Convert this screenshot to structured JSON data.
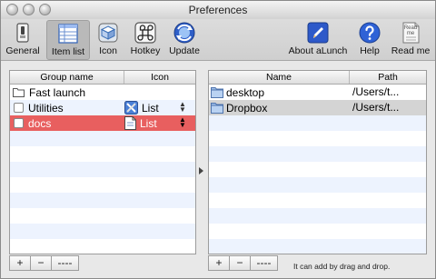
{
  "window": {
    "title": "Preferences"
  },
  "toolbar": {
    "general": "General",
    "item_list": "Item list",
    "icon": "Icon",
    "hotkey": "Hotkey",
    "update": "Update",
    "about": "About aLunch",
    "help": "Help",
    "readme": "Read me",
    "readme_icon_text": "Read me"
  },
  "groups": {
    "columns": [
      "Group name",
      "Icon"
    ],
    "rows": [
      {
        "name": "Fast launch",
        "icon_label": "",
        "kind": "folder"
      },
      {
        "name": "Utilities",
        "icon_label": "List",
        "kind": "check"
      },
      {
        "name": "docs",
        "icon_label": "List",
        "kind": "check",
        "selected": true
      }
    ]
  },
  "items": {
    "columns": [
      "Name",
      "Path"
    ],
    "rows": [
      {
        "name": "desktop",
        "path": "/Users/t..."
      },
      {
        "name": "Dropbox",
        "path": "/Users/t...",
        "selected": true
      }
    ]
  },
  "bottom": {
    "add": "+",
    "remove": "−",
    "separator": "----",
    "hint": "It can add by drag and drop."
  },
  "colors": {
    "selection_red": "#e85f5f",
    "help_blue": "#2f62d6",
    "about_blue": "#2d59c9"
  }
}
